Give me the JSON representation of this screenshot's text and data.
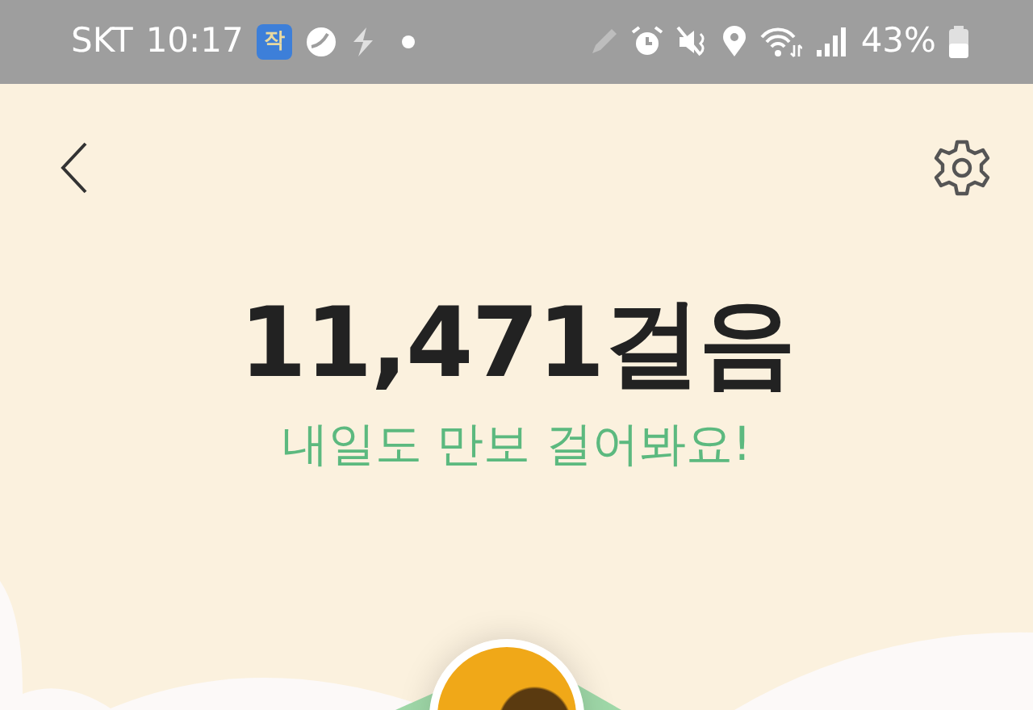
{
  "status_bar": {
    "carrier": "SKT",
    "time": "10:17",
    "app_badge": "작",
    "battery": "43%"
  },
  "header": {
    "steps": "11,471걸음",
    "message": "내일도 만보 걸어봐요!"
  }
}
